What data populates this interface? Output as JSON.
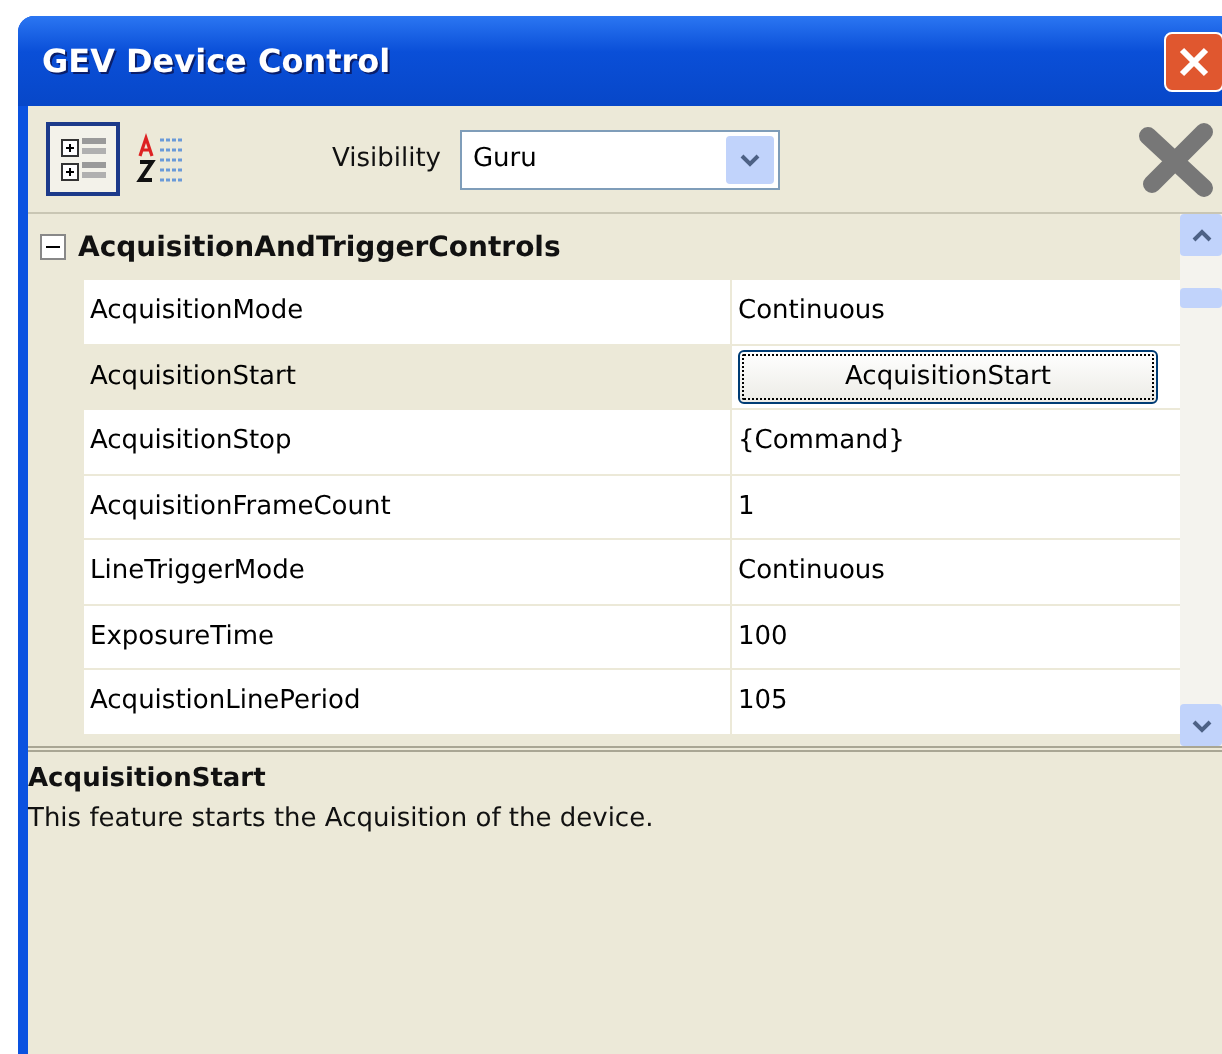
{
  "window": {
    "title": "GEV Device Control"
  },
  "toolbar": {
    "view_buttons": [
      {
        "kind": "categorized",
        "selected": true
      },
      {
        "kind": "alphabetical",
        "selected": false
      }
    ],
    "visibility_label": "Visibility",
    "visibility_value": "Guru"
  },
  "group": {
    "name": "AcquisitionAndTriggerControls",
    "expanded": true,
    "rows": [
      {
        "name": "AcquisitionMode",
        "value": "Continuous",
        "kind": "text",
        "selected": false
      },
      {
        "name": "AcquisitionStart",
        "value": "AcquisitionStart",
        "kind": "button",
        "selected": true
      },
      {
        "name": "AcquisitionStop",
        "value": "{Command}",
        "kind": "text",
        "selected": false
      },
      {
        "name": "AcquisitionFrameCount",
        "value": "1",
        "kind": "text",
        "selected": false
      },
      {
        "name": "LineTriggerMode",
        "value": "Continuous",
        "kind": "text",
        "selected": false
      },
      {
        "name": "ExposureTime",
        "value": "100",
        "kind": "text",
        "selected": false
      },
      {
        "name": "AcquistionLinePeriod",
        "value": "105",
        "kind": "text",
        "selected": false
      }
    ]
  },
  "description": {
    "title": "AcquisitionStart",
    "text": "This feature starts the Acquisition of the device."
  }
}
